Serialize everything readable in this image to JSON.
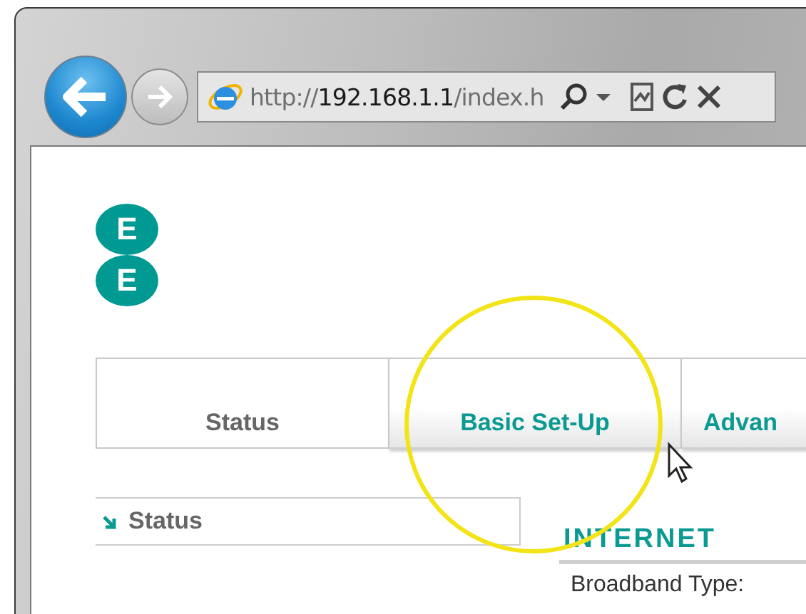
{
  "browser": {
    "address": {
      "scheme": "http://",
      "host": "192.168.1.1",
      "path": "/index.h"
    }
  },
  "logo": {
    "letters": [
      "E",
      "E"
    ]
  },
  "tabs": [
    {
      "label": "Status",
      "selected": true
    },
    {
      "label": "Basic Set-Up",
      "selected": false
    },
    {
      "label": "Advan",
      "selected": false
    }
  ],
  "sidebar": {
    "items": [
      {
        "label": "Status"
      }
    ]
  },
  "section": {
    "title": "INTERNET",
    "fields": [
      {
        "label": "Broadband Type:"
      }
    ]
  }
}
